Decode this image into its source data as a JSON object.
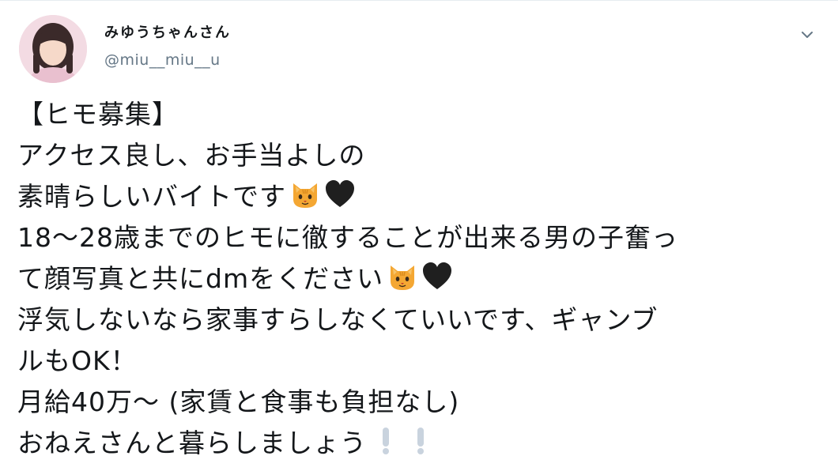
{
  "tweet": {
    "author": {
      "display_name": "みゆうちゃんさん",
      "handle": "@miu__miu__u"
    },
    "menu_icon": "chevron-down-icon",
    "lines": [
      {
        "text": "【ヒモ募集】",
        "emojis": []
      },
      {
        "text": "アクセス良し、お手当よしの",
        "emojis": []
      },
      {
        "text": "素晴らしいバイトです",
        "emojis": [
          "cat-face-emoji",
          "black-heart-emoji"
        ]
      },
      {
        "text": "18～28歳までのヒモに徹することが出来る男の子奮っ",
        "emojis": []
      },
      {
        "text": "て顔写真と共にdmをください",
        "emojis": [
          "cat-face-emoji",
          "black-heart-emoji"
        ]
      },
      {
        "text": "浮気しないなら家事すらしなくていいです、ギャンブ",
        "emojis": []
      },
      {
        "text": "ルもOK！",
        "emojis": []
      },
      {
        "text": "月給40万～ (家賃と食事も負担なし)",
        "emojis": []
      },
      {
        "text": "おねえさんと暮らしましょう",
        "emojis": [
          "exclamation-emoji",
          "exclamation-emoji"
        ]
      }
    ],
    "colors": {
      "text": "#14171a",
      "handle": "#657786",
      "cat": "#f4a733",
      "heart": "#1f1f1f",
      "exclamation": "#c9d3de"
    }
  }
}
